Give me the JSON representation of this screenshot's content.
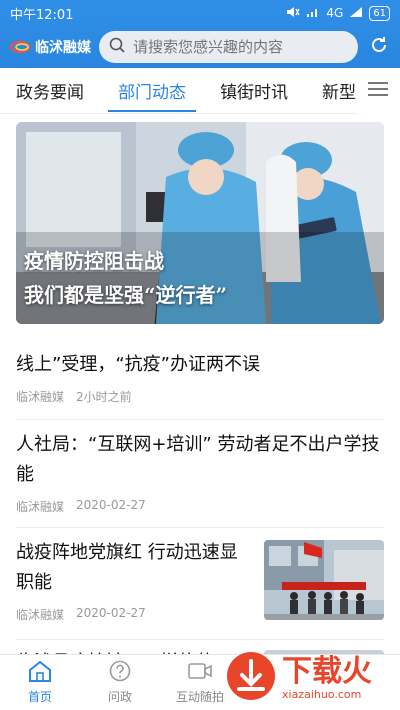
{
  "status_bar": {
    "time": "中午12:01",
    "network": "4G",
    "battery": "61"
  },
  "header": {
    "logo_text": "临沭融媒",
    "search_placeholder": "请搜索您感兴趣的内容"
  },
  "tabs": [
    {
      "label": "政务要闻"
    },
    {
      "label": "部门动态",
      "active": true
    },
    {
      "label": "镇街时讯"
    },
    {
      "label": "新型"
    }
  ],
  "hero": {
    "caption_line1": "疫情防控阻击战",
    "caption_line2": "我们都是坚强“逆行者”"
  },
  "news": [
    {
      "title": "线上”受理，“抗疫”办证两不误",
      "source": "临沭融媒",
      "time": "2小时之前"
    },
    {
      "title": "人社局：“互联网+培训” 劳动者足不出户学技能",
      "source": "临沭融媒",
      "time": "2020-02-27"
    },
    {
      "title": "战疫阵地党旗红 行动迅速显职能",
      "source": "临沭融媒",
      "time": "2020-02-27"
    },
    {
      "title": "临沭县疾控馆……样的使……"
    }
  ],
  "bottom_nav": [
    {
      "label": "首页",
      "active": true
    },
    {
      "label": "问政"
    },
    {
      "label": "互动随拍"
    }
  ],
  "watermark": {
    "big": "下载火",
    "small": "xiazaihuo.com"
  },
  "colors": {
    "brand_blue": "#2a86e0",
    "watermark_red": "#e8452a"
  }
}
